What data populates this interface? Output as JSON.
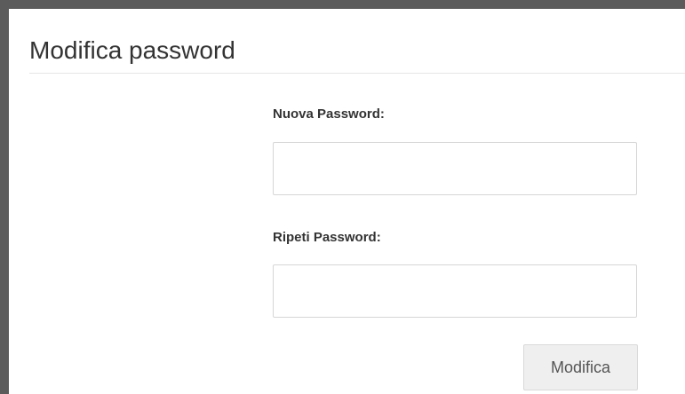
{
  "page": {
    "title": "Modifica password"
  },
  "form": {
    "new_password_label": "Nuova Password:",
    "new_password_value": "",
    "repeat_password_label": "Ripeti Password:",
    "repeat_password_value": "",
    "submit_label": "Modifica"
  },
  "colors": {
    "frame_border": "#5b5b5b",
    "text": "#333333",
    "button_background": "#efefef",
    "field_border": "#d6d6d6"
  }
}
